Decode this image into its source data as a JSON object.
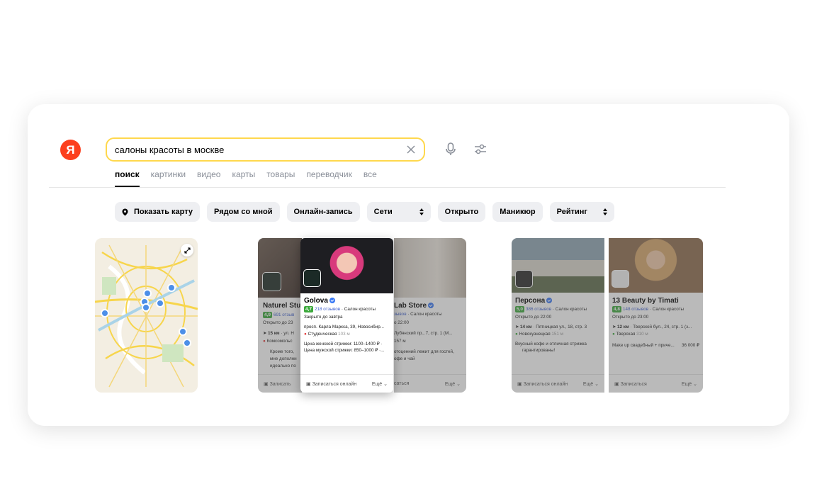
{
  "logo": {
    "letter": "Я"
  },
  "search": {
    "value": "салоны красоты в москве"
  },
  "tabs": [
    {
      "label": "поиск"
    },
    {
      "label": "картинки"
    },
    {
      "label": "видео"
    },
    {
      "label": "карты"
    },
    {
      "label": "товары"
    },
    {
      "label": "переводчик"
    },
    {
      "label": "все"
    }
  ],
  "chips": {
    "show_map": "Показать карту",
    "nearby": "Рядом со мной",
    "online": "Онлайн-запись",
    "chains": "Сети",
    "open": "Открыто",
    "manicure": "Маникюр",
    "rating": "Рейтинг"
  },
  "results": {
    "naturel": {
      "title": "Naturel Stu",
      "rating": "4,9",
      "reviews": "691 отзыв",
      "hours": "Открыто до 23",
      "distance": "15 км",
      "address": "ул. Н",
      "metro": "Комсомольс",
      "review_1": "Кроме того,",
      "review_2": "мне дополни",
      "review_3": "идеально по",
      "book": "Записать"
    },
    "golova": {
      "title": "Golova",
      "rating": "4,7",
      "reviews": "218 отзывов",
      "category": "Салон красоты",
      "hours": "Закрыто до завтра",
      "address": "просп. Карла Маркса, 39, Новосибир...",
      "metro": "Студенческая",
      "metro_dist": "103 м",
      "price_1": "Цена женской стрижки: 1100–1400 ₽ ·",
      "price_2": "Цена мужской стрижки: 850–1000 ₽ ·...",
      "book": "Записаться онлайн",
      "more": "Ещё"
    },
    "lab": {
      "title": "Lab Store",
      "reviews": "зывов",
      "category": "Салон красоты",
      "hours": "о 22:00",
      "address": "Лубянский пр., 7, стр. 1 (М...",
      "dist": "157 м",
      "review_1": "отоценний лежит для гостей,",
      "review_2": "офе и чай",
      "book": "саться",
      "more": "Ещё"
    },
    "persona": {
      "title": "Персона",
      "rating": "5,0",
      "reviews": "386 отзывов",
      "category": "Салон красоты",
      "hours": "Открыто до 22:00",
      "distance": "14 км",
      "address": "Пятницкая ул., 18, стр. 3",
      "metro": "Новокузнецкая",
      "metro_dist": "151 м",
      "review_1": "Вкусный кофе и отличная стрижка",
      "review_2": "гарантированы!",
      "book": "Записаться онлайн",
      "more": "Ещё"
    },
    "beauty13": {
      "title": "13 Beauty by Timati",
      "rating": "4,8",
      "reviews": "148 отзывов",
      "category": "Салон красоты",
      "hours": "Открыто до 23:00",
      "distance": "12 км",
      "address": "Тверской бул., 24, стр. 1 (з...",
      "metro": "Тверская",
      "metro_dist": "310 м",
      "service": "Make up свадебный + приче...",
      "price": "36 000 ₽",
      "book": "Записаться",
      "more": "Ещё"
    }
  },
  "colors": {
    "accent": "#fc3f1d",
    "search_border": "#ffd84d",
    "rating": "#3ca93c",
    "link": "#3a5ccc"
  }
}
